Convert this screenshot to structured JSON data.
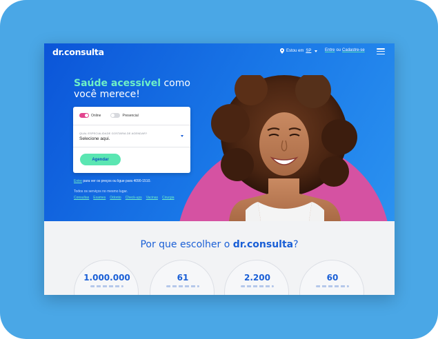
{
  "header": {
    "logo": "dr.consulta",
    "location_prefix": "Estou em",
    "location_city": "SP",
    "login_label": "Entre",
    "or_label": "ou",
    "signup_label": "Cadastre-se",
    "menu_icon": "hamburger-menu-icon"
  },
  "hero": {
    "headline_accent": "Saúde acessível",
    "headline_rest": " como você merece!",
    "toggle_online": "Online",
    "toggle_presencial": "Presencial",
    "online_selected": true,
    "specialty_label": "QUAL ESPECIALIDADE GOSTARIA DE AGENDAR?",
    "specialty_value": "Selecione aqui.",
    "submit_label": "Agendar",
    "price_link": "Entre",
    "price_note": " para ver os preços ou ligue para 4090-1510.",
    "services_title": "Todos os serviços no mesmo lugar.",
    "services": [
      "Consultas",
      "Exames",
      "Odonto",
      "Check-ups",
      "Vacinas",
      "Cirurgia"
    ]
  },
  "why": {
    "title_prefix": "Por que escolher o ",
    "title_brand": "dr.consulta",
    "title_suffix": "?",
    "stats": [
      "1.000.000",
      "61",
      "2.200",
      "60"
    ]
  },
  "colors": {
    "frame": "#4aa7e6",
    "hero_blue": "#0b55d8",
    "accent_green": "#6ff0c6",
    "button_green": "#5be6b2",
    "pink": "#d552a2",
    "brand_blue": "#1a5fd6"
  }
}
